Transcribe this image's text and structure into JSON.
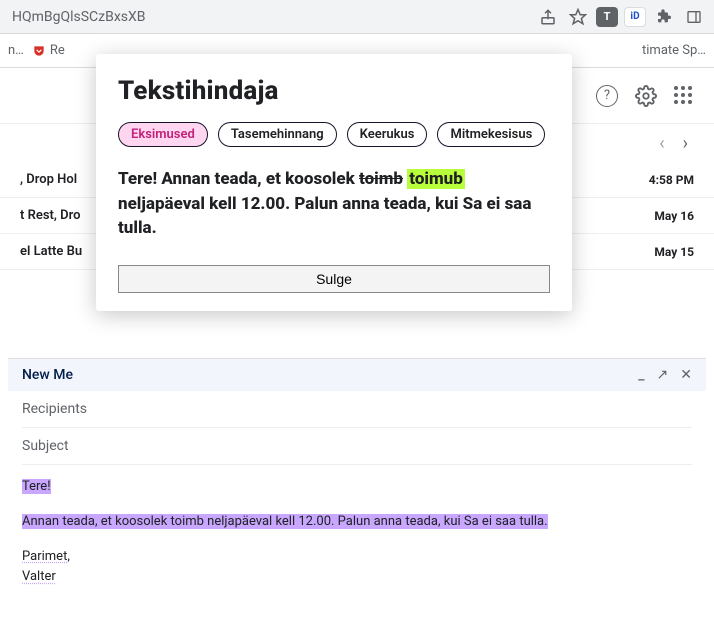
{
  "browser": {
    "address": "HQmBgQlsSCzBxsXB",
    "ext_t": "T",
    "ext_id": "iD",
    "bookmark_left_trunc": "n…",
    "bookmark_re": "Re",
    "bookmark_right_trunc": "timate Sp…"
  },
  "mail": {
    "pager_prev": "‹",
    "pager_next": "›",
    "rows": [
      {
        "snippet": ", Drop Hol",
        "time": "4:58 PM"
      },
      {
        "snippet": "t Rest, Dro",
        "time": "May 16"
      },
      {
        "snippet": "el Latte Bu",
        "time": "May 15"
      }
    ]
  },
  "compose": {
    "title": "New Me",
    "recipients_label": "Recipients",
    "subject_label": "Subject",
    "body": {
      "greeting": "Tere",
      "greeting_punct": "!",
      "para_prefix": "Annan ",
      "w_teada1": "teada",
      "para_mid1": ", et ",
      "w_koosolek": "koosolek",
      "sp1": " ",
      "w_toimb": "toimb",
      "sp2": " ",
      "w_nelja": "neljapäeval",
      "sp3": " ",
      "w_kell": "kell",
      "para_mid2": " 12.00. Palun anna ",
      "w_teada2": "teada",
      "para_mid3": ", kui Sa ",
      "w_ei": "ei",
      "sp4": " ",
      "w_saa": "saa",
      "sp5": " ",
      "w_tulla": "tulla",
      "para_end": ".",
      "sign1": "Parimet",
      "sign1_punct": ",",
      "sign2": "Valter"
    }
  },
  "popup": {
    "title": "Tekstihindaja",
    "tabs": {
      "eksimused": "Eksimused",
      "tasemehinnang": "Tasemehinnang",
      "keerukus": "Keerukus",
      "mitmekesisus": "Mitmekesisus"
    },
    "text": {
      "p1a": "Tere! Annan teada, et koosolek ",
      "strike": "toimb",
      "space": " ",
      "suggest": "toimub",
      "p1b": " neljapäeval kell 12.00. Palun anna teada, kui Sa ei saa tulla."
    },
    "close": "Sulge"
  }
}
